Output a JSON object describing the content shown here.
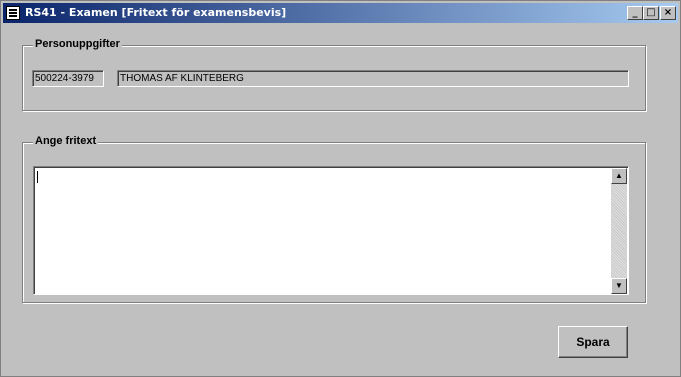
{
  "window": {
    "title": "RS41 - Examen [Fritext för examensbevis]",
    "controls": {
      "minimize": "_",
      "maximize": "□",
      "close": "×"
    }
  },
  "personuppgifter": {
    "legend": "Personuppgifter",
    "personnummer": "500224-3979",
    "namn": "THOMAS AF KLINTEBERG"
  },
  "fritext": {
    "legend": "Ange fritext",
    "value": ""
  },
  "actions": {
    "save_label": "Spara"
  },
  "icons": {
    "scroll_up": "▲",
    "scroll_down": "▼"
  }
}
